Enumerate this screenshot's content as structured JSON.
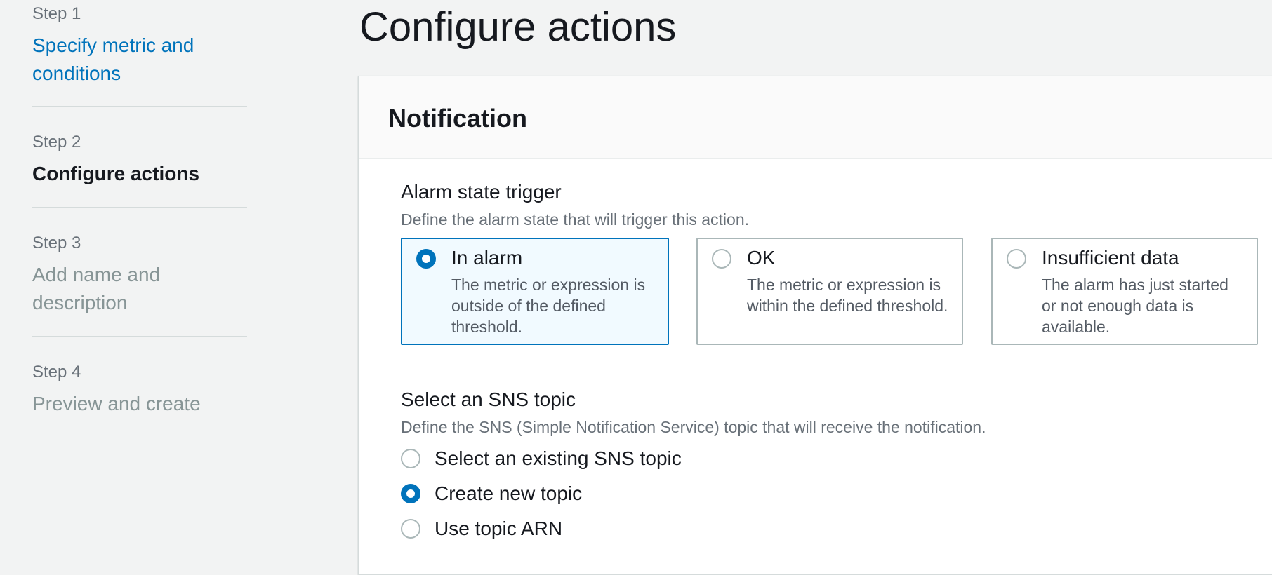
{
  "wizard": {
    "steps": [
      {
        "number": "Step 1",
        "title": "Specify metric and conditions",
        "state": "link"
      },
      {
        "number": "Step 2",
        "title": "Configure actions",
        "state": "current"
      },
      {
        "number": "Step 3",
        "title": "Add name and description",
        "state": "disabled"
      },
      {
        "number": "Step 4",
        "title": "Preview and create",
        "state": "disabled"
      }
    ]
  },
  "page": {
    "title": "Configure actions"
  },
  "notification": {
    "header": "Notification",
    "alarm_state_trigger": {
      "label": "Alarm state trigger",
      "description": "Define the alarm state that will trigger this action.",
      "options": [
        {
          "title": "In alarm",
          "description": "The metric or expression is outside of the defined threshold.",
          "selected": true
        },
        {
          "title": "OK",
          "description": "The metric or expression is within the defined threshold.",
          "selected": false
        },
        {
          "title": "Insufficient data",
          "description": "The alarm has just started or not enough data is available.",
          "selected": false
        }
      ]
    },
    "sns_topic": {
      "label": "Select an SNS topic",
      "description": "Define the SNS (Simple Notification Service) topic that will receive the notification.",
      "options": [
        {
          "label": "Select an existing SNS topic",
          "selected": false
        },
        {
          "label": "Create new topic",
          "selected": true
        },
        {
          "label": "Use topic ARN",
          "selected": false
        }
      ]
    }
  },
  "colors": {
    "accent": "#0073bb",
    "link": "#0073bb",
    "background": "#f2f3f3"
  }
}
